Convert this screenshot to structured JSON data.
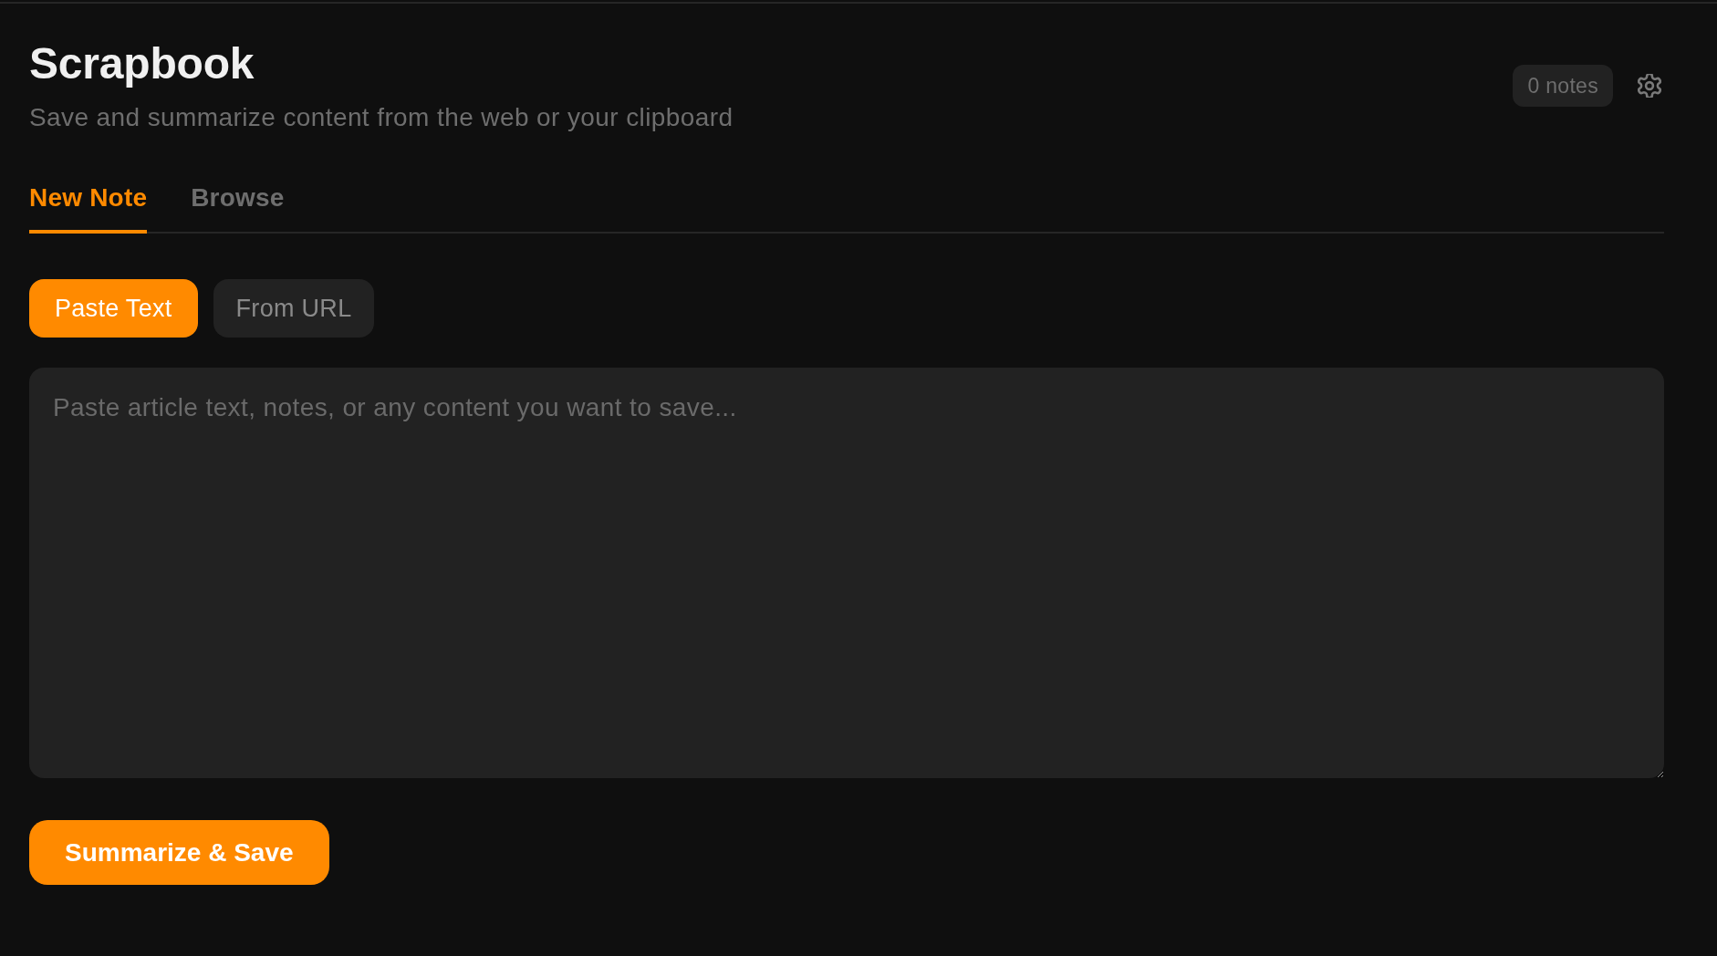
{
  "header": {
    "title": "Scrapbook",
    "subtitle": "Save and summarize content from the web or your clipboard",
    "note_count": "0 notes"
  },
  "tabs": [
    {
      "label": "New Note",
      "selected": true
    },
    {
      "label": "Browse",
      "selected": false
    }
  ],
  "input_modes": [
    {
      "label": "Paste Text",
      "selected": true
    },
    {
      "label": "From URL",
      "selected": false
    }
  ],
  "content_field": {
    "placeholder": "Paste article text, notes, or any content you want to save..."
  },
  "submit_button": {
    "label": "Summarize & Save"
  }
}
